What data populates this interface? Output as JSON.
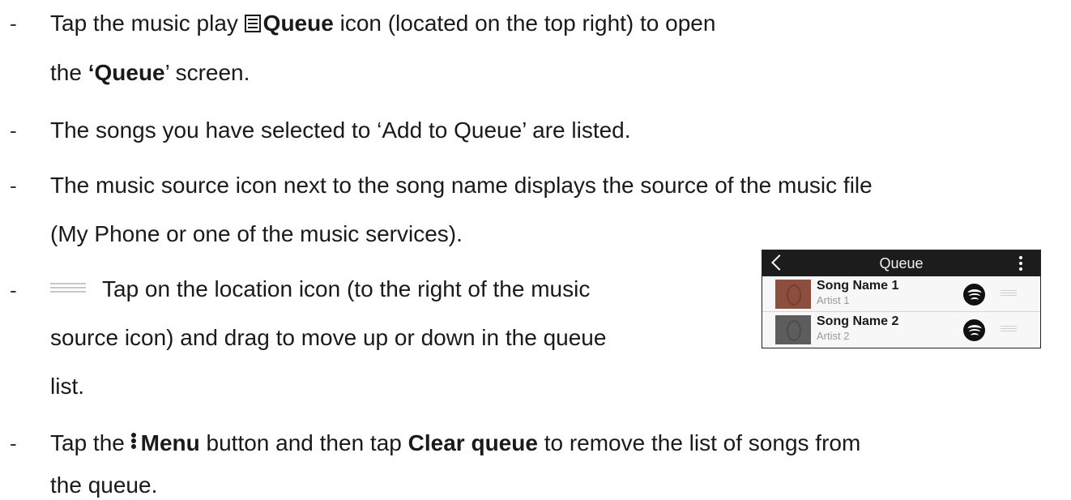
{
  "bullet_marker": "-",
  "items": [
    {
      "line1": {
        "pre": "Tap the music play ",
        "bold": "Queue",
        "post": " icon (located on the top right) to open"
      },
      "line2": {
        "pre": "the ",
        "bold": "‘Queue",
        "post": "’ screen."
      }
    },
    {
      "text": "The songs you have selected to ‘Add to Queue’ are listed."
    },
    {
      "line1": "The music source icon next to the song name displays the source of the music file",
      "line2": "(My Phone or one of the music services)."
    },
    {
      "line1": "Tap on the location icon (to the right of the music",
      "line2": "source icon) and drag to move up or down in the queue",
      "line3": "list."
    },
    {
      "line1": {
        "pre": "Tap the ",
        "bold1": "Menu",
        "mid": " button and then tap ",
        "bold2": "Clear queue",
        "post": " to remove the list of songs from"
      },
      "line2": "the queue."
    }
  ],
  "mockup": {
    "title": "Queue",
    "songs": [
      {
        "name": "Song Name 1",
        "artist": "Artist 1",
        "thumb_color": "#8c4e3d",
        "source_icon": "spotify-icon"
      },
      {
        "name": "Song Name 2",
        "artist": "Artist 2",
        "thumb_color": "#5d5d5d",
        "source_icon": "spotify-icon"
      }
    ]
  },
  "icons": {
    "queue": "queue-list-icon",
    "menu": "vertical-dots-menu-icon",
    "drag": "drag-handle-icon",
    "back": "back-chevron-icon"
  }
}
